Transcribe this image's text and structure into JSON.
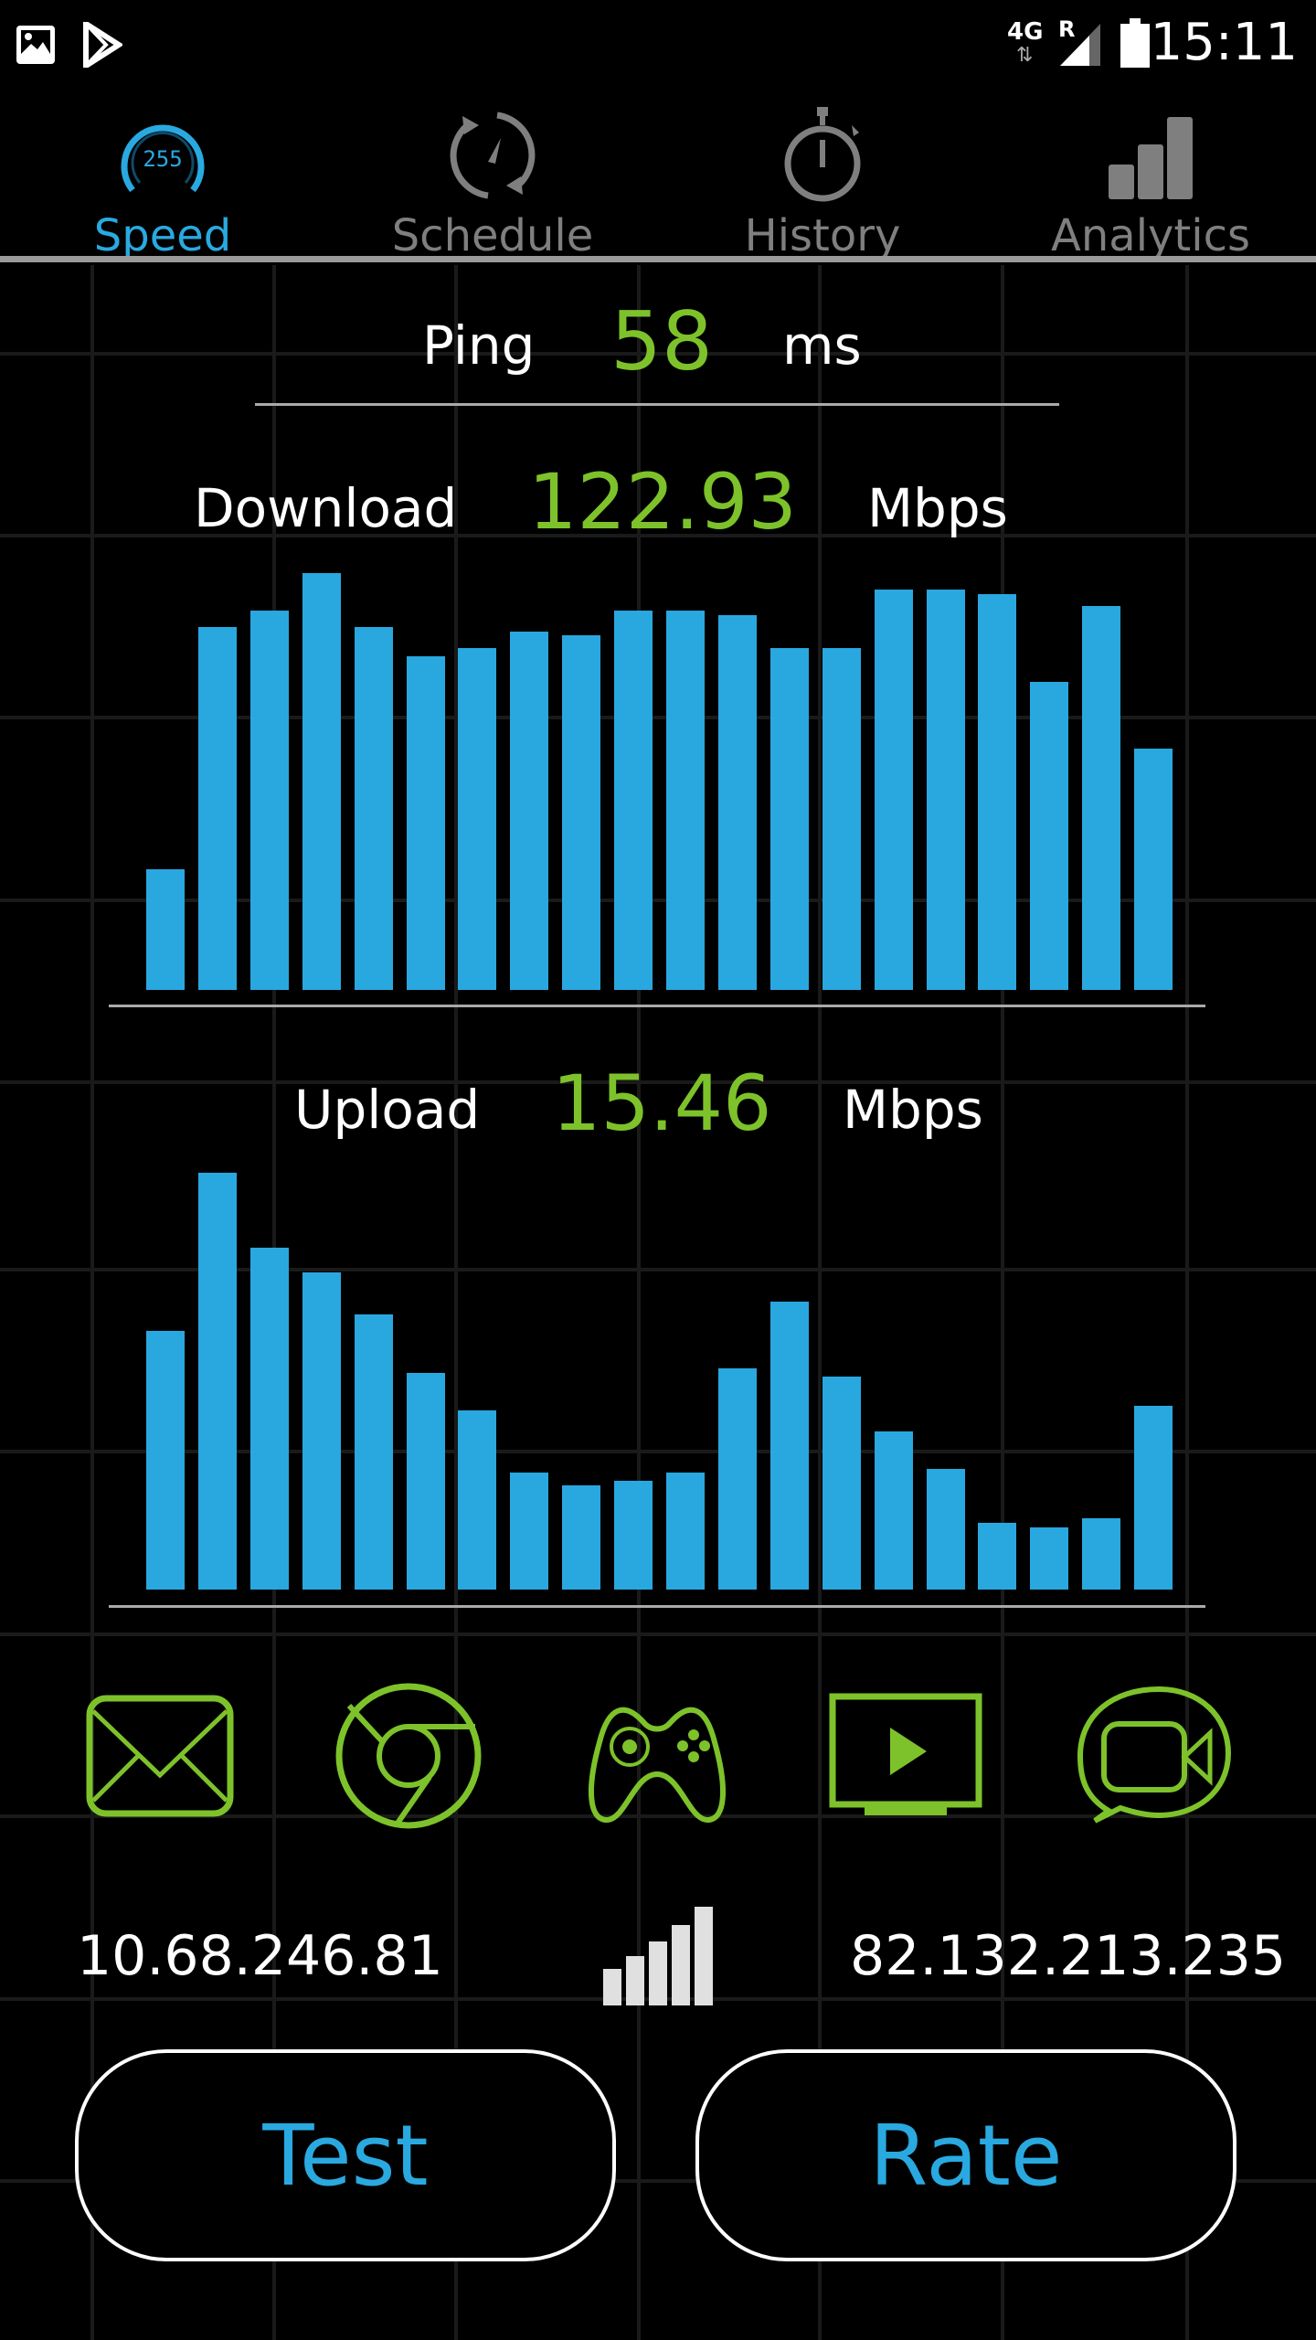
{
  "status_bar": {
    "time": "15:11",
    "network": "4G",
    "roaming": "R",
    "left_icons": [
      "image-icon",
      "play-store-icon"
    ]
  },
  "tabs": [
    {
      "label": "Speed",
      "icon": "speedometer-icon",
      "active": true,
      "icon_text": "255"
    },
    {
      "label": "Schedule",
      "icon": "schedule-icon",
      "active": false
    },
    {
      "label": "History",
      "icon": "stopwatch-icon",
      "active": false
    },
    {
      "label": "Analytics",
      "icon": "bar-chart-icon",
      "active": false
    }
  ],
  "ping": {
    "label": "Ping",
    "value": "58",
    "unit": "ms"
  },
  "download": {
    "label": "Download",
    "value": "122.93",
    "unit": "Mbps",
    "samples_pct": [
      29,
      87,
      91,
      100,
      87,
      80,
      82,
      86,
      85,
      91,
      91,
      90,
      82,
      82,
      96,
      96,
      95,
      74,
      92,
      58
    ]
  },
  "upload": {
    "label": "Upload",
    "value": "15.46",
    "unit": "Mbps",
    "samples_pct": [
      62,
      100,
      82,
      76,
      66,
      52,
      43,
      28,
      25,
      26,
      28,
      53,
      69,
      51,
      38,
      29,
      16,
      15,
      17,
      44
    ]
  },
  "app_icons": [
    "email-icon",
    "browser-icon",
    "gamepad-icon",
    "video-play-icon",
    "video-chat-icon"
  ],
  "local_ip": "10.68.246.81",
  "external_ip": "82.132.213.235",
  "buttons": {
    "test": "Test",
    "rate": "Rate"
  },
  "colors": {
    "accent_blue": "#29a9e0",
    "value_green": "#7dc22a",
    "inactive_gray": "#7f7f7f"
  }
}
